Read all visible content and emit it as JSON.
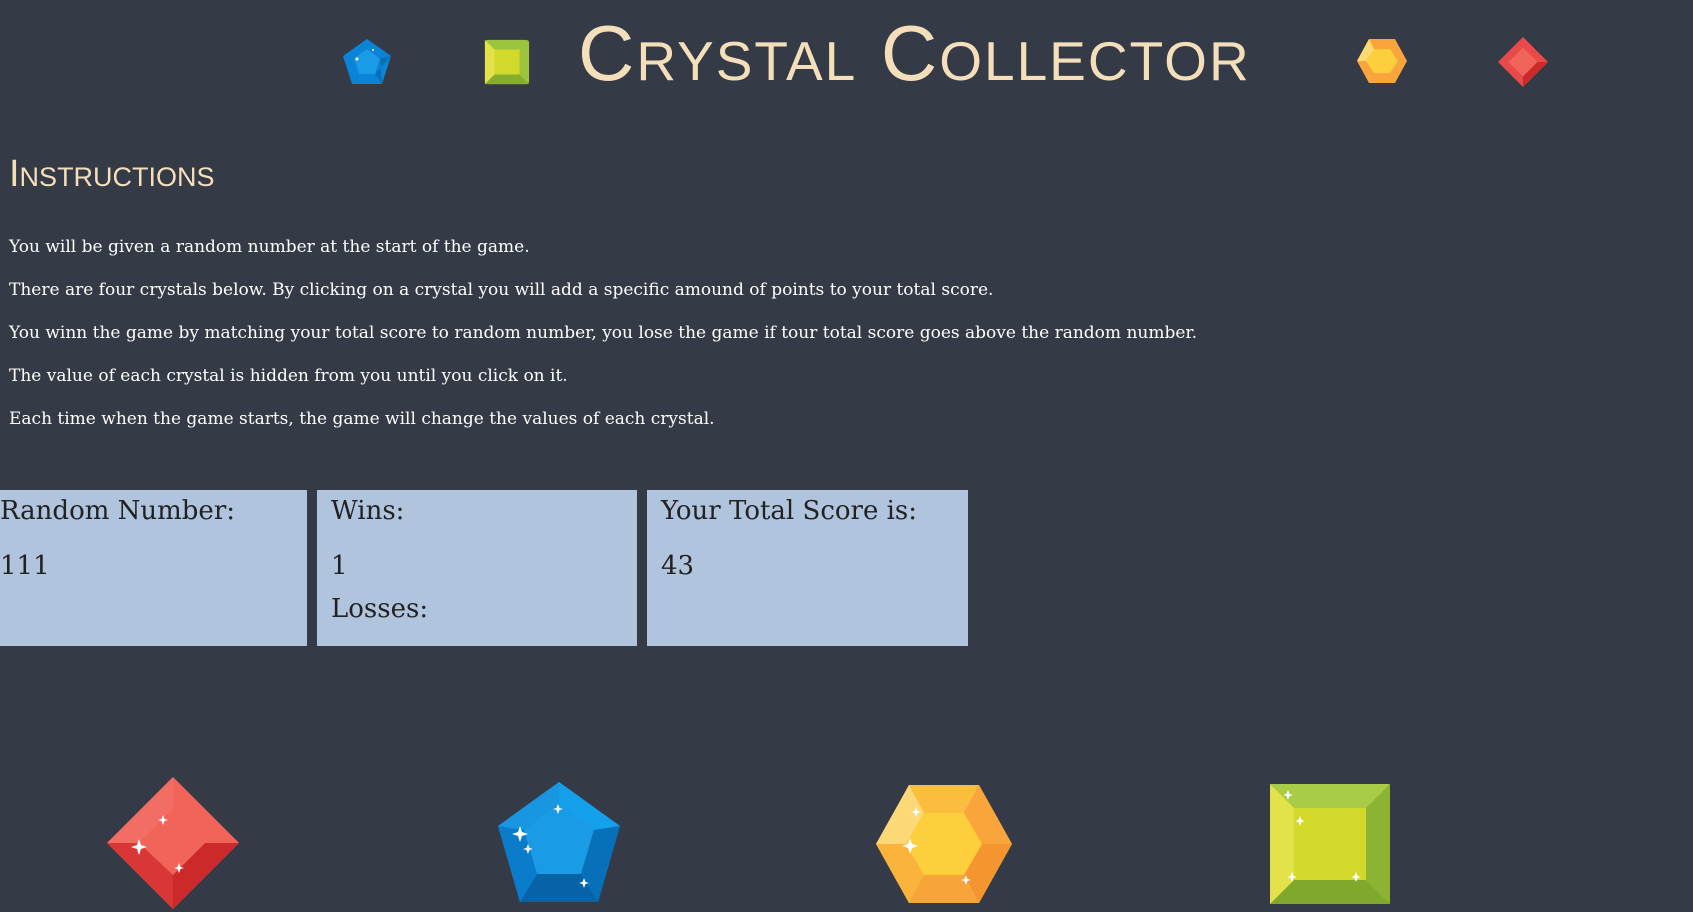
{
  "header": {
    "title": "Crystal Collector",
    "decor_icons": [
      "blue-pentagon-gem-icon",
      "green-square-gem-icon",
      "yellow-hexagon-gem-icon",
      "red-diamond-gem-icon"
    ]
  },
  "instructions": {
    "title": "Instructions",
    "lines": [
      "You will be given a random number at the start of the game.",
      "There are four crystals below. By clicking on a crystal you will add a specific amound of points to your total score.",
      "You winn the game by matching your total score to random number, you lose the game if tour total score goes above the random number.",
      "The value of each crystal is hidden from you until you click on it.",
      "Each time when the game starts, the game will change the values of each crystal."
    ]
  },
  "stats": {
    "random_label": "Random Number:",
    "random_value": "111",
    "wins_label": "Wins:",
    "wins_value": "1",
    "losses_label": "Losses:",
    "score_label": "Your Total Score is:",
    "score_value": "43"
  },
  "crystals": [
    "red-diamond-crystal",
    "blue-pentagon-crystal",
    "yellow-hexagon-crystal",
    "green-square-crystal"
  ],
  "colors": {
    "background": "#343a46",
    "title": "#f5dfbb",
    "panel": "#b0c4de",
    "red": "#e84a4a",
    "blue": "#0a84d6",
    "yellow": "#fbbd3e",
    "green": "#9bc53d"
  }
}
